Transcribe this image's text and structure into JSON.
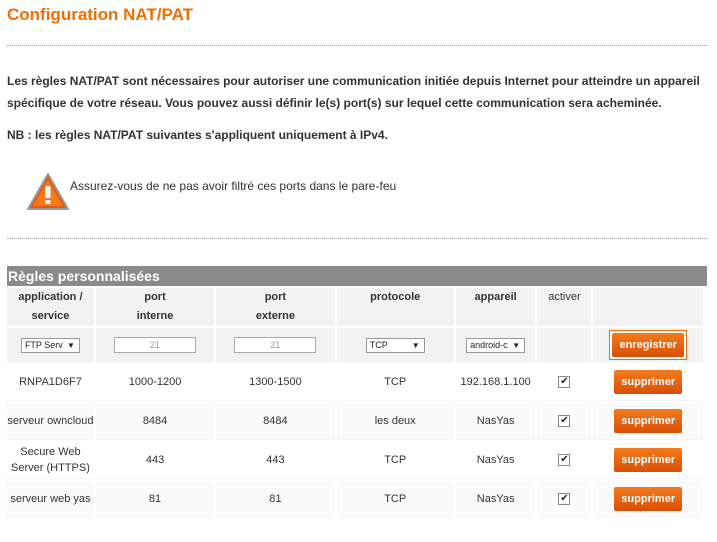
{
  "page": {
    "title": "Configuration NAT/PAT",
    "intro": "Les règles NAT/PAT sont nécessaires pour autoriser une communication initiée depuis Internet pour atteindre un appareil spécifique de votre réseau. Vous pouvez aussi définir le(s) port(s) sur lequel cette communication sera acheminée.",
    "nb": "NB : les règles NAT/PAT suivantes s'appliquent uniquement à IPv4.",
    "warning": "Assurez-vous de ne pas avoir filtré ces ports dans le pare-feu"
  },
  "section": {
    "title": "Règles personnalisées"
  },
  "columns": {
    "app_line1": "application /",
    "app_line2": "service",
    "port_int_line1": "port",
    "port_int_line2": "interne",
    "port_ext_line1": "port",
    "port_ext_line2": "externe",
    "protocol": "protocole",
    "device": "appareil",
    "activate": "activer"
  },
  "new_rule": {
    "application": "FTP Serv",
    "port_internal_placeholder": "21",
    "port_external_placeholder": "21",
    "protocol": "TCP",
    "device": "android-c",
    "save_label": "enregistrer"
  },
  "rules": [
    {
      "application": "RNPA1D6F7",
      "port_internal": "1000-1200",
      "port_external": "1300-1500",
      "protocol": "TCP",
      "device": "192.168.1.100",
      "active": true,
      "delete_label": "supprimer"
    },
    {
      "application": "serveur owncloud",
      "port_internal": "8484",
      "port_external": "8484",
      "protocol": "les deux",
      "device": "NasYas",
      "active": true,
      "delete_label": "supprimer"
    },
    {
      "application": "Secure Web Server (HTTPS)",
      "port_internal": "443",
      "port_external": "443",
      "protocol": "TCP",
      "device": "NasYas",
      "active": true,
      "delete_label": "supprimer"
    },
    {
      "application": "serveur web yas",
      "port_internal": "81",
      "port_external": "81",
      "protocol": "TCP",
      "device": "NasYas",
      "active": true,
      "delete_label": "supprimer"
    }
  ],
  "colors": {
    "accent": "#f16e00",
    "button": "#e8590c",
    "header_bar": "#8a8a8a"
  },
  "icons": {
    "warning": "warning-triangle-icon",
    "dropdown": "chevron-down-icon",
    "checkbox": "checkmark-icon"
  }
}
